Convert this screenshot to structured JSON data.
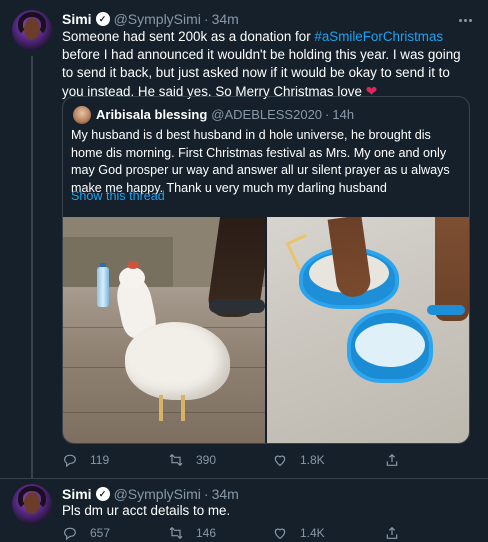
{
  "tweet1": {
    "name": "Simi",
    "handle": "@SymplySimi",
    "time": "34m",
    "text_part1": "Someone had sent 200k as a donation for ",
    "hashtag": "#aSmileForChristmas",
    "text_part2": " before I had announced it wouldn't be holding this year. I was going to send it back, but just asked now if it would be okay to send it to you instead. He said yes. So Merry Christmas love ",
    "quoted": {
      "name": "Aribisala blessing",
      "handle": "@ADEBLESS2020",
      "time": "14h",
      "text": "My husband is d best husband in d hole universe, he brought dis home dis morning. First Christmas festival as Mrs. My one and only may God prosper ur way and answer all ur silent prayer as u always make me happy. Thank u very much my darling husband",
      "show_thread": "Show this thread"
    },
    "actions": {
      "replies": "119",
      "retweets": "390",
      "likes": "1.8K"
    }
  },
  "tweet2": {
    "name": "Simi",
    "handle": "@SymplySimi",
    "time": "34m",
    "text": "Pls dm ur acct details to me.",
    "actions": {
      "replies": "657",
      "retweets": "146",
      "likes": "1.4K"
    }
  },
  "colors": {
    "background": "#15202b",
    "accent": "#1da1f2",
    "muted": "#8899a6",
    "border": "#38444d",
    "heart": "#e0245e"
  },
  "icons": [
    "verified-icon",
    "more-icon",
    "reply-icon",
    "retweet-icon",
    "like-icon",
    "share-icon",
    "heart-emoji-icon"
  ]
}
